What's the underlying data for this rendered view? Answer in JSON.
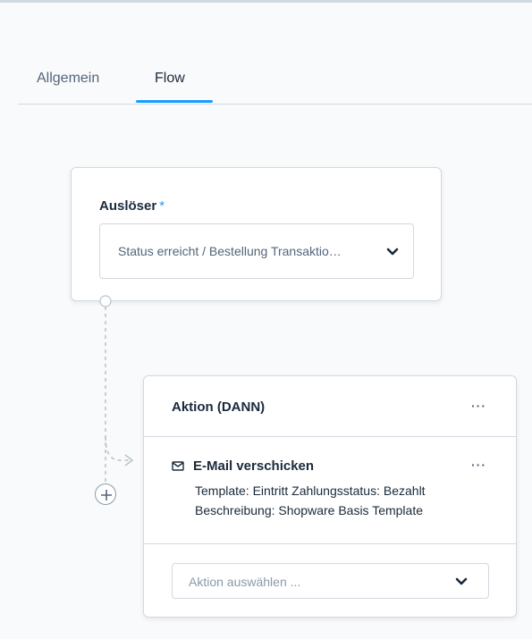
{
  "tabs": [
    {
      "label": "Allgemein",
      "active": false
    },
    {
      "label": "Flow",
      "active": true
    }
  ],
  "trigger": {
    "label": "Auslöser",
    "required_marker": "*",
    "selected_value": "Status erreicht / Bestellung Transaktio…"
  },
  "action_block": {
    "title": "Aktion (DANN)",
    "menu_label": "···",
    "items": [
      {
        "icon": "mail-icon",
        "title": "E-Mail verschicken",
        "menu_label": "···",
        "line1": "Template: Eintritt Zahlungsstatus: Bezahlt",
        "line2": "Beschreibung: Shopware Basis Template"
      }
    ],
    "select_placeholder": "Aktion auswählen ..."
  },
  "colors": {
    "accent": "#189eff",
    "border": "#d1d9e0",
    "text_dark": "#1a2a3a",
    "text_muted": "#52667a"
  }
}
